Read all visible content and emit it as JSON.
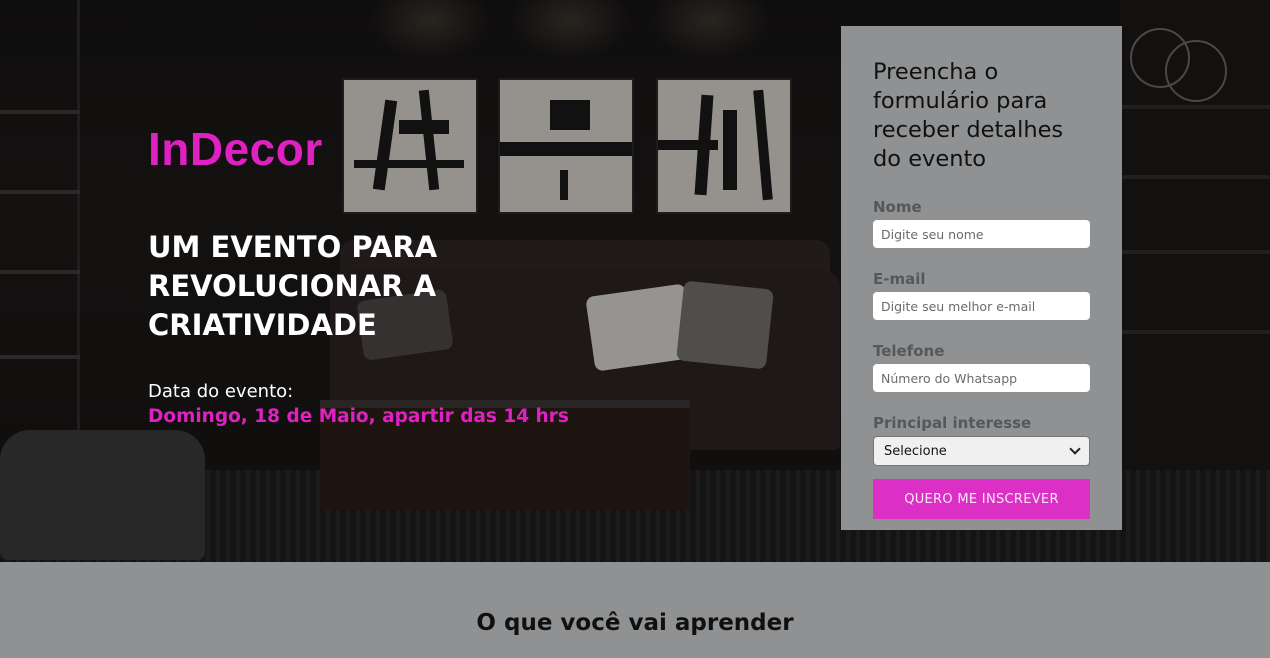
{
  "hero": {
    "brand": "InDecor",
    "headline_lines": [
      "UM EVENTO PARA",
      "REVOLUCIONAR A",
      "CRIATIVIDADE"
    ],
    "date_label": "Data do evento:",
    "date_value": "Domingo, 18 de Maio, apartir das 14 hrs"
  },
  "form": {
    "title_lines": [
      "Preencha o",
      "formulário para",
      "receber detalhes",
      "do evento"
    ],
    "fields": [
      {
        "label": "Nome",
        "placeholder": "Digite seu nome"
      },
      {
        "label": "E-mail",
        "placeholder": "Digite seu melhor e-mail"
      },
      {
        "label": "Telefone",
        "placeholder": "Número do Whatsapp"
      }
    ],
    "select_label": "Principal interesse",
    "select_value": "Selecione",
    "submit_label": "QUERO ME INSCREVER"
  },
  "learn": {
    "title": "O que você vai aprender"
  },
  "colors": {
    "accent": "#e021c2",
    "button": "#db2fc6",
    "panel": "#8f9193"
  }
}
